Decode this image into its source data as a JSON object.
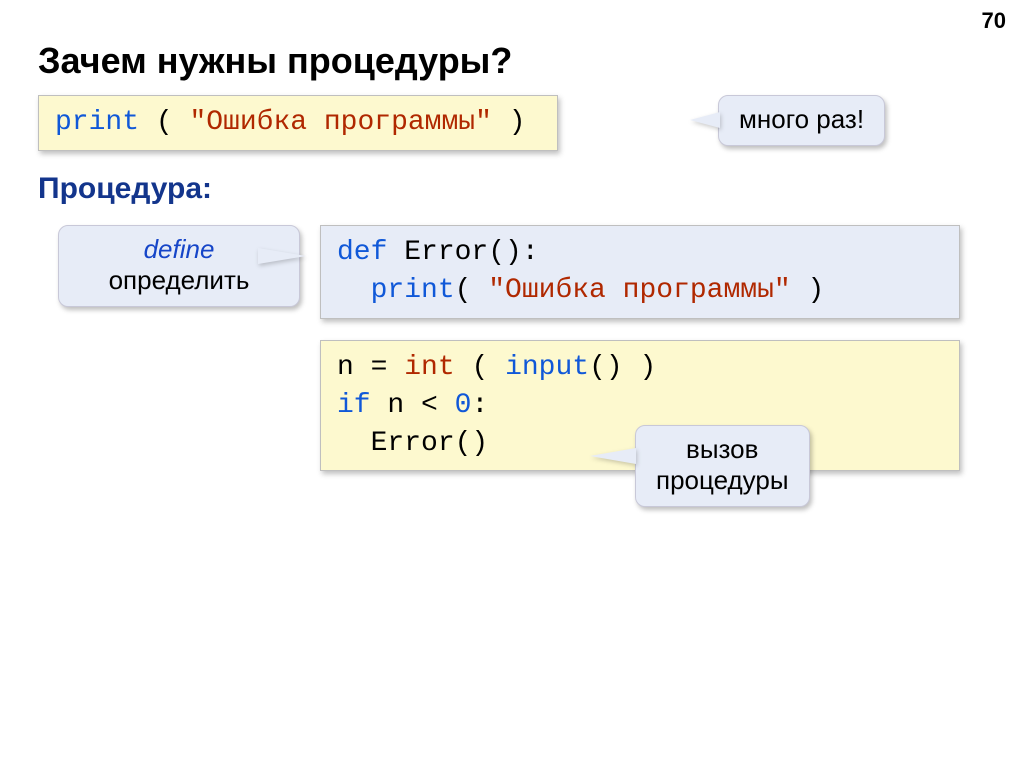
{
  "page_number": "70",
  "title": "Зачем нужны процедуры?",
  "subhead": "Процедура:",
  "callouts": {
    "many": {
      "line1": "много раз!"
    },
    "define": {
      "line1": "define",
      "line2": "определить"
    },
    "call": {
      "line1": "вызов",
      "line2": "процедуры"
    }
  },
  "code": {
    "box1": {
      "t1": "print",
      "t2": " ( ",
      "t3": "\"Ошибка программы\"",
      "t4": " )"
    },
    "box2": {
      "l1t1": "def",
      "l1t2": " Error():",
      "l2pad": "  ",
      "l2t1": "print",
      "l2t2": "( ",
      "l2t3": "\"Ошибка программы\"",
      "l2t4": " )"
    },
    "box3": {
      "l1t1": "n = ",
      "l1t2": "int",
      "l1t3": " ( ",
      "l1t4": "input",
      "l1t5": "() )",
      "l2t1": "if",
      "l2t2": " n < ",
      "l2t3": "0",
      "l2t4": ":",
      "l3pad": "  ",
      "l3t1": "Error()"
    }
  }
}
